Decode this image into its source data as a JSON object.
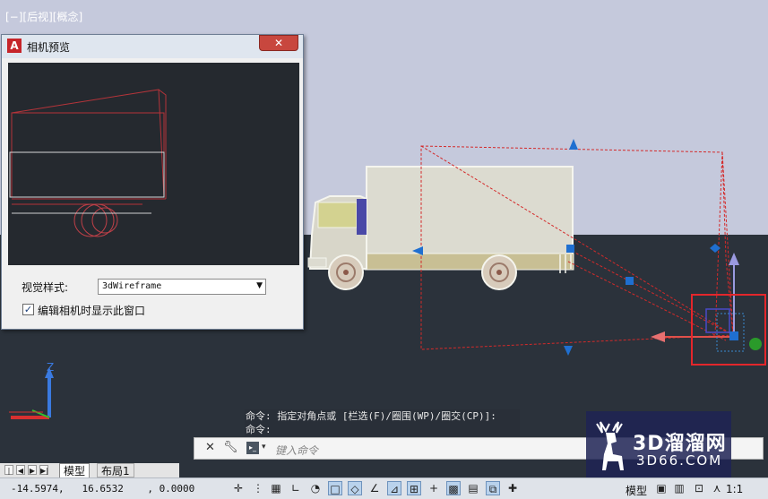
{
  "viewport": {
    "label": "[−][后视][概念]"
  },
  "camera_preview_dialog": {
    "title": "相机预览",
    "close_icon": "close-icon",
    "visual_style_label": "视觉样式:",
    "visual_style_value": "3dWireframe",
    "checkbox_checked": true,
    "checkbox_label": "编辑相机时显示此窗口"
  },
  "command_window": {
    "history": [
      "命令: 指定对角点或 [栏选(F)/圈围(WP)/圈交(CP)]:",
      "命令:"
    ],
    "input_placeholder": "键入命令"
  },
  "layout_tabs": {
    "tabs": [
      "模型",
      "布局1"
    ],
    "active": "模型"
  },
  "status_bar": {
    "coordinates": "-14.5974,   16.6532    , 0.0000",
    "model_label": "模型",
    "scale": "1:1"
  },
  "axes": {
    "z_label": "Z"
  },
  "watermark": {
    "line1": "3D溜溜网",
    "line2": "3D66.COM"
  },
  "colors": {
    "sky": "#c5c9dc",
    "ground": "#2b323b",
    "camera_frustum": "#d42a2a",
    "grip_blue": "#1f6fd0",
    "highlight_frame": "#e3262b"
  }
}
